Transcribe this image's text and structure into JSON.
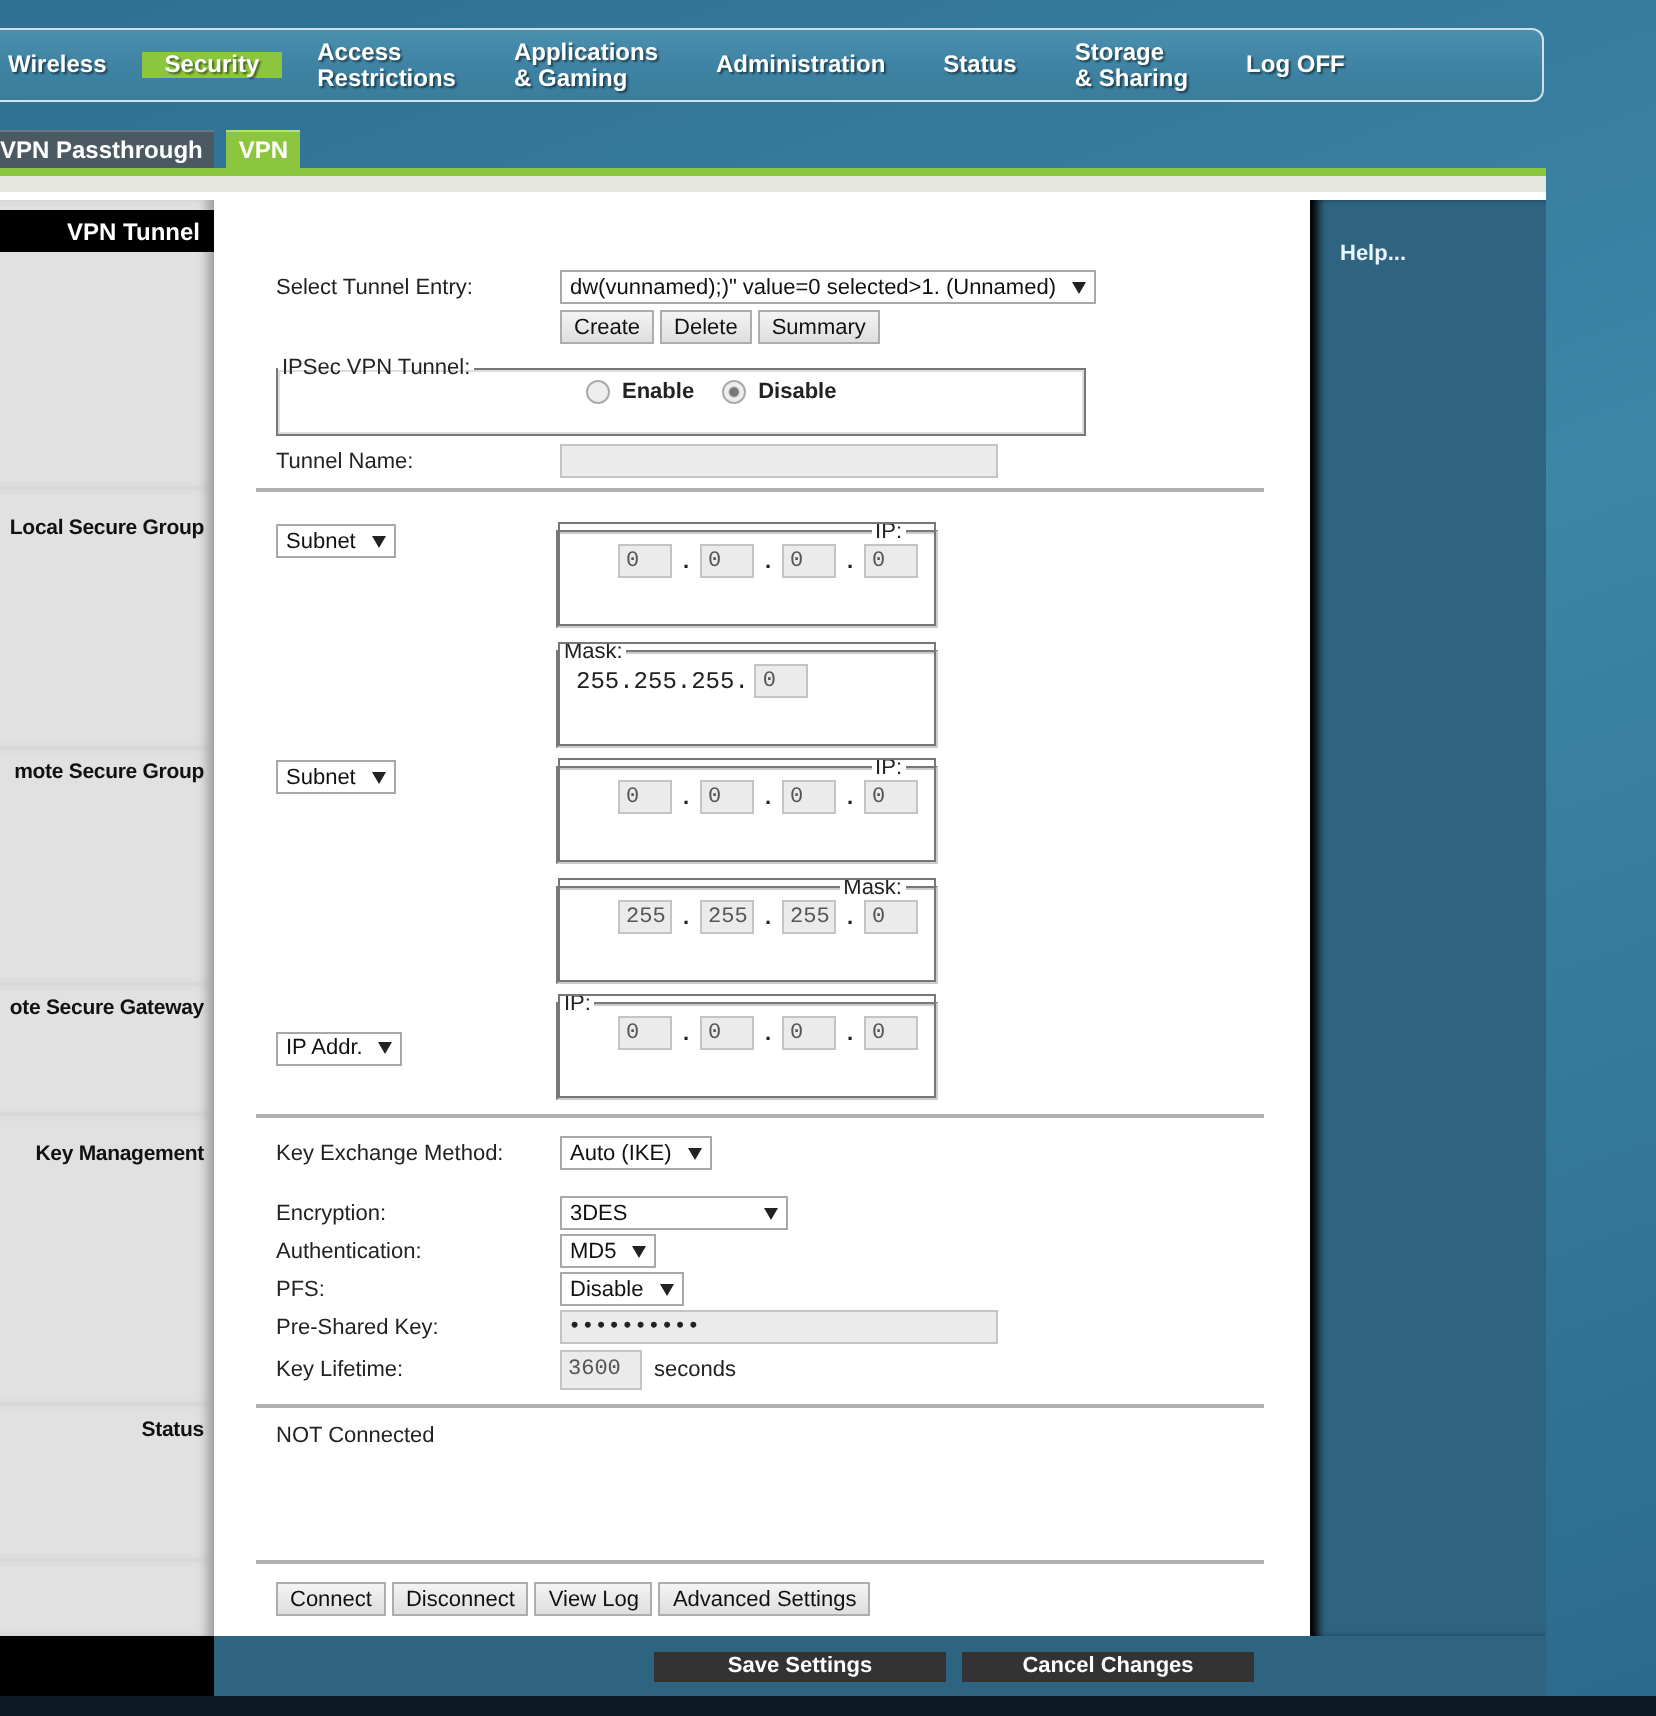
{
  "nav": [
    {
      "label": "Wireless",
      "selected": false
    },
    {
      "label": "Security",
      "selected": true
    },
    {
      "label": "Access\nRestrictions",
      "selected": false
    },
    {
      "label": "Applications\n& Gaming",
      "selected": false
    },
    {
      "label": "Administration",
      "selected": false
    },
    {
      "label": "Status",
      "selected": false
    },
    {
      "label": "Storage\n& Sharing",
      "selected": false
    },
    {
      "label": "Log OFF",
      "selected": false
    }
  ],
  "subtabs": [
    {
      "label": "VPN Passthrough",
      "selected": false
    },
    {
      "label": "VPN",
      "selected": true
    }
  ],
  "tunnel": {
    "title": "VPN Tunnel",
    "entry_label": "Select Tunnel Entry:",
    "entry_value": "dw(vunnamed);)\" value=0 selected>1. (Unnamed)",
    "entry_buttons": [
      "Create",
      "Delete",
      "Summary"
    ],
    "ipsec": {
      "legend": "IPSec VPN Tunnel:",
      "options": [
        {
          "label": "Enable",
          "selected": false
        },
        {
          "label": "Disable",
          "selected": true
        }
      ]
    },
    "name_label": "Tunnel Name:"
  },
  "groups": [
    {
      "title": "Local Secure Group",
      "type": "Subnet",
      "boxes": [
        {
          "legend": "IP:",
          "legend_right": true,
          "octets": [
            "0",
            "0",
            "0",
            "0"
          ],
          "separators": [
            ".",
            ".",
            "."
          ]
        },
        {
          "legend": "Mask:",
          "legend_right": false,
          "prefix": "255.255.255.",
          "octets": [
            "0"
          ]
        }
      ]
    },
    {
      "title": "mote Secure Group",
      "type": "Subnet",
      "boxes": [
        {
          "legend": "IP:",
          "legend_right": true,
          "octets": [
            "0",
            "0",
            "0",
            "0"
          ],
          "separators": [
            ".",
            ".",
            "."
          ]
        },
        {
          "legend": "Mask:",
          "legend_right": true,
          "octets": [
            "255",
            "255",
            "255",
            "0"
          ],
          "separators": [
            ".",
            ".",
            "."
          ]
        }
      ]
    },
    {
      "title": "ote Secure Gateway",
      "type": "IP Addr.",
      "boxes": [
        {
          "legend": "IP:",
          "legend_right": false,
          "octets": [
            "0",
            "0",
            "0",
            "0"
          ],
          "separators": [
            ".",
            ".",
            "."
          ]
        }
      ]
    }
  ],
  "key_management": {
    "title": "Key Management",
    "exchange": {
      "label": "Key Exchange Method:",
      "value": "Auto (IKE)"
    },
    "rows": [
      {
        "kind": "select",
        "label": "Encryption:",
        "value": "3DES"
      },
      {
        "kind": "select",
        "label": "Authentication:",
        "value": "MD5"
      },
      {
        "kind": "select",
        "label": "PFS:",
        "value": "Disable"
      },
      {
        "kind": "secret",
        "label": "Pre-Shared Key:",
        "value": "••••••••••"
      },
      {
        "kind": "number",
        "label": "Key Lifetime:",
        "value": "3600",
        "unit": "seconds"
      }
    ]
  },
  "status": {
    "title": "Status",
    "value": "NOT Connected"
  },
  "actions": [
    "Connect",
    "Disconnect",
    "View Log",
    "Advanced Settings"
  ],
  "help": "Help...",
  "footer": [
    "Save Settings",
    "Cancel Changes"
  ]
}
